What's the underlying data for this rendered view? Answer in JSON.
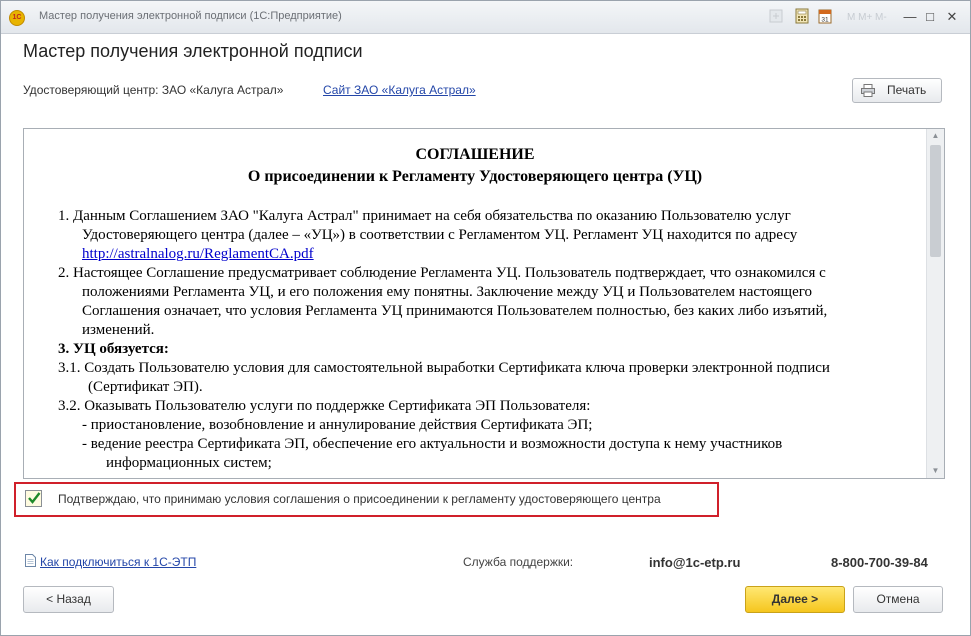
{
  "window": {
    "title": "Мастер получения электронной подписи  (1С:Предприятие)",
    "app_icon_text": "1С"
  },
  "heading": "Мастер получения электронной подписи",
  "ca": {
    "label": "Удостоверяющий центр: ЗАО «Калуга Астрал»",
    "link": "Сайт ЗАО «Калуга Астрал»"
  },
  "print_label": "Печать",
  "agreement": {
    "title": "СОГЛАШЕНИЕ",
    "subtitle": "О присоединении к Регламенту Удостоверяющего центра (УЦ)",
    "lines": {
      "l1": "1.   Данным Соглашением ЗАО \"Калуга Астрал\" принимает на себя обязательства по оказанию Пользователю услуг",
      "l2": "Удостоверяющего центра (далее – «УЦ») в соответствии с Регламентом УЦ. Регламент УЦ находится по адресу",
      "l3_link": "http://astralnalog.ru/ReglamentCA.pdf",
      "l4": "2.   Настоящее Соглашение предусматривает соблюдение Регламента УЦ. Пользователь подтверждает, что ознакомился с",
      "l5": "положениями Регламента УЦ, и его положения ему понятны. Заключение между УЦ и Пользователем настоящего",
      "l6": "Соглашения означает, что условия Регламента УЦ принимаются Пользователем полностью, без каких либо изъятий,",
      "l7": "изменений.",
      "l8": "3.   УЦ обязуется:",
      "l9": "3.1.  Создать Пользователю условия для самостоятельной выработки Сертификата ключа проверки электронной подписи",
      "l10": "(Сертификат ЭП).",
      "l11": "3.2.  Оказывать Пользователю услуги по поддержке Сертификата ЭП Пользователя:",
      "l12": "-      приостановление, возобновление и аннулирование действия Сертификата ЭП;",
      "l13": "-      ведение реестра Сертификата ЭП, обеспечение его актуальности и возможности доступа к нему участников",
      "l14": "информационных систем;"
    }
  },
  "confirm": {
    "checked": true,
    "label": "Подтверждаю, что принимаю условия соглашения о присоединении к регламенту удостоверяющего центра"
  },
  "footer": {
    "help_link": "Как подключиться к 1С-ЭТП",
    "support_label": "Служба поддержки:",
    "support_email": "info@1c-etp.ru",
    "support_phone": "8-800-700-39-84"
  },
  "buttons": {
    "back": "< Назад",
    "next": "Далее >",
    "cancel": "Отмена"
  },
  "colors": {
    "highlight_border": "#d0202a",
    "next_button": "#f5c61e",
    "link": "#2346a8"
  }
}
